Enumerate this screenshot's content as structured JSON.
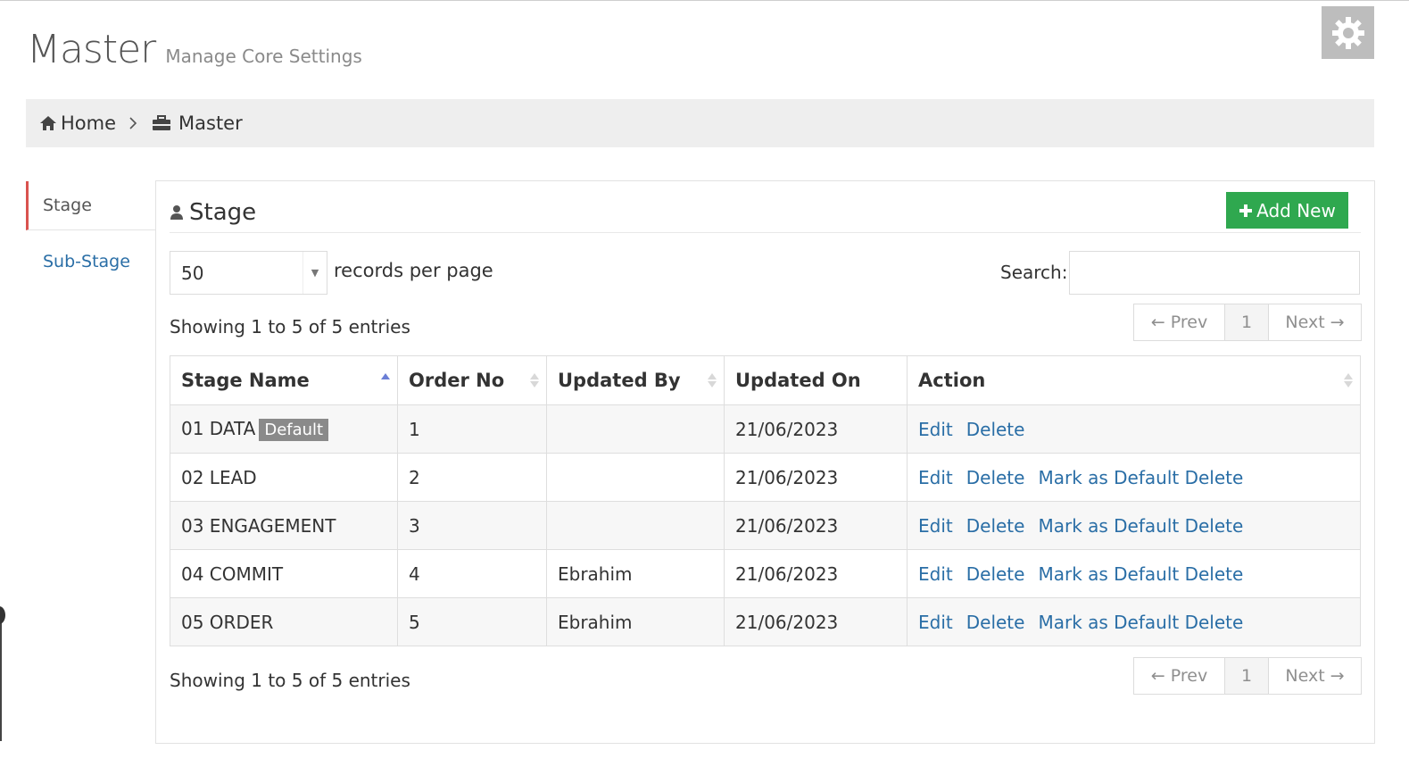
{
  "header": {
    "title": "Master",
    "subtitle": "Manage Core Settings"
  },
  "breadcrumb": {
    "home": "Home",
    "current": "Master"
  },
  "sidebar": {
    "items": [
      {
        "label": "Stage",
        "active": true
      },
      {
        "label": "Sub-Stage",
        "active": false
      }
    ]
  },
  "panel": {
    "title": "Stage",
    "add_button": "Add New"
  },
  "controls": {
    "records_per_page_value": "50",
    "records_per_page_label": "records per page",
    "search_label": "Search:",
    "search_value": ""
  },
  "info": {
    "top": "Showing 1 to 5 of 5 entries",
    "bottom": "Showing 1 to 5 of 5 entries"
  },
  "pagination": {
    "prev": "← Prev",
    "page": "1",
    "next": "Next →"
  },
  "table": {
    "columns": [
      "Stage Name",
      "Order No",
      "Updated By",
      "Updated On",
      "Action"
    ],
    "rows": [
      {
        "name": "01 DATA",
        "badge": "Default",
        "order": "1",
        "updated_by": "",
        "updated_on": "21/06/2023",
        "edit": "Edit",
        "delete": "Delete",
        "mark": ""
      },
      {
        "name": "02 LEAD",
        "badge": "",
        "order": "2",
        "updated_by": "",
        "updated_on": "21/06/2023",
        "edit": "Edit",
        "delete": "Delete",
        "mark": "Mark as Default Delete"
      },
      {
        "name": "03 ENGAGEMENT",
        "badge": "",
        "order": "3",
        "updated_by": "",
        "updated_on": "21/06/2023",
        "edit": "Edit",
        "delete": "Delete",
        "mark": "Mark as Default Delete"
      },
      {
        "name": "04 COMMIT",
        "badge": "",
        "order": "4",
        "updated_by": "Ebrahim",
        "updated_on": "21/06/2023",
        "edit": "Edit",
        "delete": "Delete",
        "mark": "Mark as Default Delete"
      },
      {
        "name": "05 ORDER",
        "badge": "",
        "order": "5",
        "updated_by": "Ebrahim",
        "updated_on": "21/06/2023",
        "edit": "Edit",
        "delete": "Delete",
        "mark": "Mark as Default Delete"
      }
    ]
  },
  "colors": {
    "accent": "#d9534f",
    "link": "#2a6ea6",
    "add_button": "#2fa84f",
    "badge": "#8a8a8a"
  },
  "icons": [
    "gear-icon",
    "home-icon",
    "chevron-right-icon",
    "briefcase-icon",
    "user-icon",
    "plus-icon"
  ]
}
